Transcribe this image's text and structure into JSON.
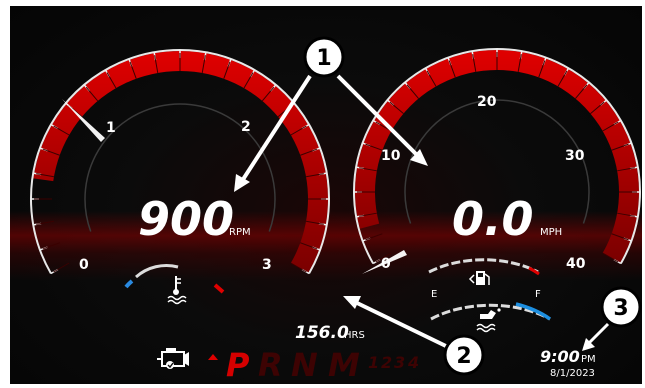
{
  "tachometer": {
    "value": "900",
    "unit": "RPM",
    "ticks": [
      "0",
      "1",
      "2",
      "3"
    ],
    "level_fraction": 0.0
  },
  "speedometer": {
    "value": "0.0",
    "unit": "MPH",
    "ticks": [
      "0",
      "10",
      "20",
      "30",
      "40"
    ],
    "level_fraction": 0.0
  },
  "fuel": {
    "empty_label": "E",
    "full_label": "F",
    "icon": "fuel-pump-icon"
  },
  "oil": {
    "icon": "oil-can-icon"
  },
  "temperature": {
    "icon": "coolant-temperature-icon"
  },
  "engine_hours": {
    "value": "156.0",
    "unit": "HRS"
  },
  "gears": {
    "items": [
      "P",
      "R",
      "N",
      "M",
      "1",
      "2",
      "3",
      "4"
    ],
    "selected": "P"
  },
  "clock": {
    "time": "9:00",
    "ampm": "PM",
    "date": "8/1/2023"
  },
  "callouts": [
    "1",
    "2",
    "3"
  ],
  "colors": {
    "accent_red": "#d50000",
    "arc_red": "#b30000",
    "blue": "#1d8fe0",
    "panel": "#090909"
  }
}
